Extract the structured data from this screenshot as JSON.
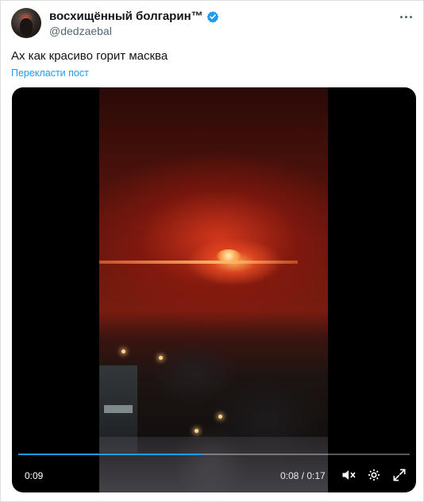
{
  "tweet": {
    "display_name": "восхищённый болгарин™",
    "handle": "@dedzaebal",
    "text": "Ах как красиво горит масква",
    "translate_label": "Перекласти пост"
  },
  "video": {
    "elapsed": "0:09",
    "position_total": "0:08 / 0:17",
    "progress_fraction": 0.47
  },
  "icons": {
    "verified": "verified-badge-icon",
    "more": "more-options-icon",
    "volume": "volume-muted-icon",
    "settings": "settings-gear-icon",
    "fullscreen": "fullscreen-icon"
  },
  "colors": {
    "accent": "#1d9bf0",
    "text_primary": "#0f1419",
    "text_secondary": "#536471"
  }
}
